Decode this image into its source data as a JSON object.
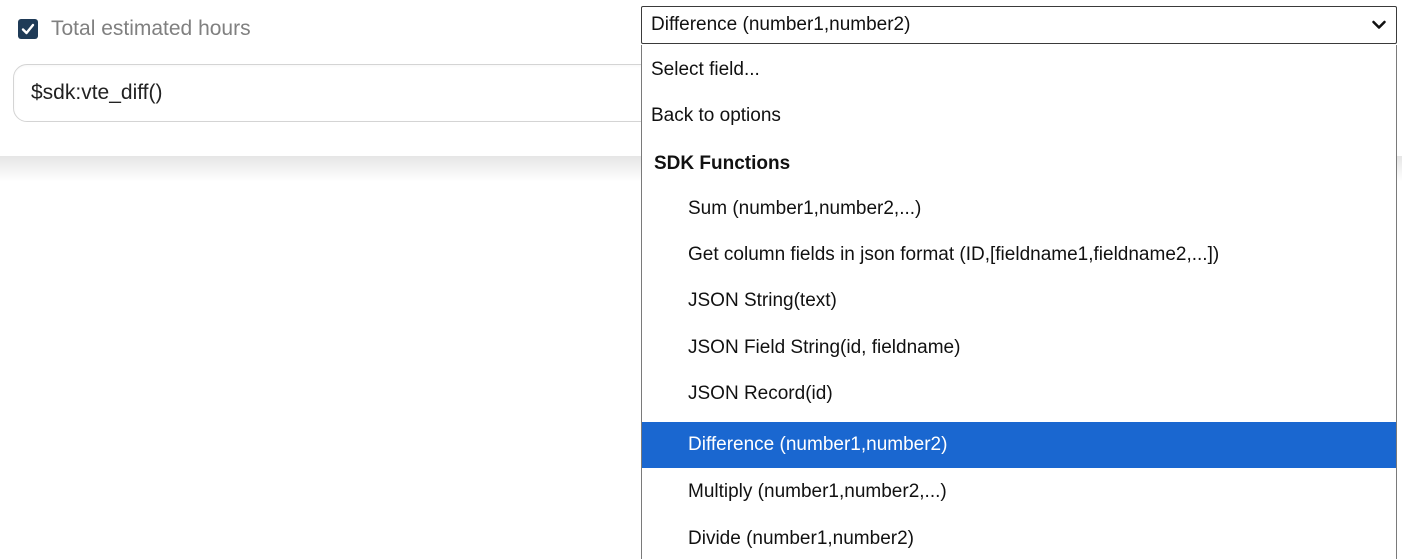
{
  "field": {
    "checkbox_checked": true,
    "label": "Total estimated hours",
    "formula_value": "$sdk:vte_diff()"
  },
  "select": {
    "value": "Difference (number1,number2)"
  },
  "dropdown": {
    "options": {
      "select_field": "Select field...",
      "back_to_options": "Back to options"
    },
    "group": {
      "label": "SDK Functions",
      "items": [
        "Sum (number1,number2,...)",
        "Get column fields in json format (ID,[fieldname1,fieldname2,...])",
        "JSON String(text)",
        "JSON Field String(id, fieldname)",
        "JSON Record(id)",
        "Difference (number1,number2)",
        "Multiply (number1,number2,...)",
        "Divide (number1,number2)"
      ],
      "selected_index": 5
    }
  },
  "colors": {
    "checkbox": "#1f3b57",
    "selected_bg": "#1a67d0",
    "selected_text": "#ffffff"
  },
  "icons": {
    "checkbox": "checkmark-icon",
    "select": "chevron-down-icon"
  }
}
